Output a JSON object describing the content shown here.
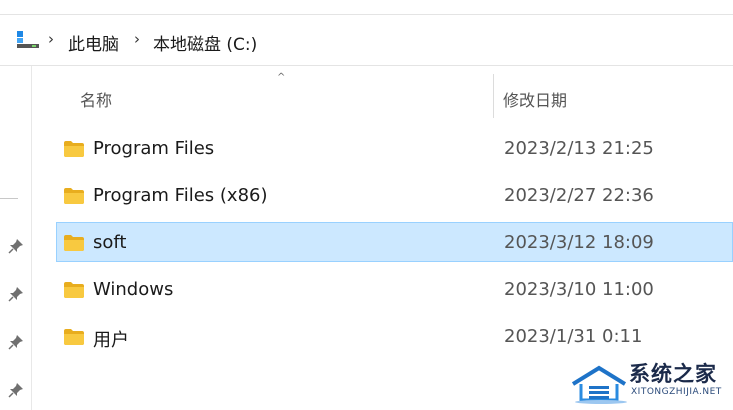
{
  "breadcrumb": {
    "items": [
      "此电脑",
      "本地磁盘 (C:)"
    ]
  },
  "columns": {
    "name": "名称",
    "date_modified": "修改日期"
  },
  "files": [
    {
      "name": "Program Files",
      "date": "2023/2/13 21:25",
      "selected": false
    },
    {
      "name": "Program Files (x86)",
      "date": "2023/2/27 22:36",
      "selected": false
    },
    {
      "name": "soft",
      "date": "2023/3/12 18:09",
      "selected": true
    },
    {
      "name": "Windows",
      "date": "2023/3/10 11:00",
      "selected": false
    },
    {
      "name": "用户",
      "date": "2023/1/31 0:11",
      "selected": false
    }
  ],
  "watermark": {
    "title": "系统之家",
    "subtitle": "XITONGZHIJIA.NET"
  },
  "colors": {
    "selection": "#cce8ff",
    "selection_border": "#99d1ff",
    "folder": "#f8c940"
  }
}
